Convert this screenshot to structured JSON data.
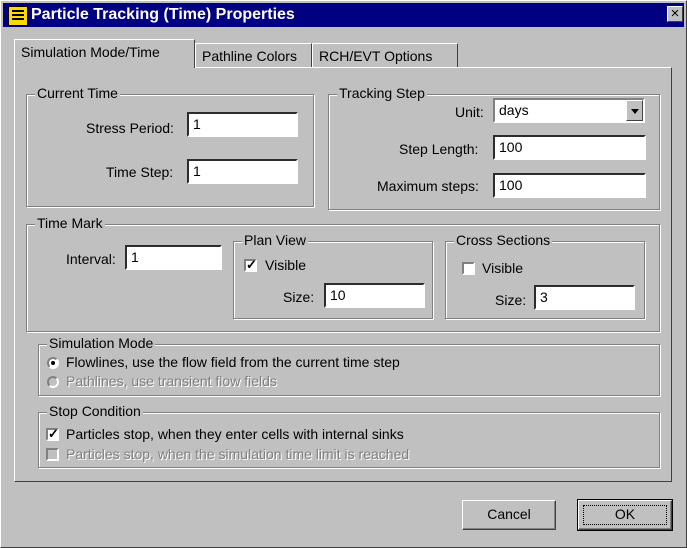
{
  "window": {
    "title": "Particle Tracking (Time) Properties",
    "close_label": "×"
  },
  "tabs": [
    {
      "label": "Simulation Mode/Time"
    },
    {
      "label": "Pathline Colors"
    },
    {
      "label": "RCH/EVT Options"
    }
  ],
  "current_time": {
    "legend": "Current Time",
    "stress_period_label": "Stress Period:",
    "stress_period_value": "1",
    "time_step_label": "Time Step:",
    "time_step_value": "1"
  },
  "tracking_step": {
    "legend": "Tracking Step",
    "unit_label": "Unit:",
    "unit_value": "days",
    "step_length_label": "Step Length:",
    "step_length_value": "100",
    "max_steps_label": "Maximum steps:",
    "max_steps_value": "100"
  },
  "time_mark": {
    "legend": "Time Mark",
    "interval_label": "Interval:",
    "interval_value": "1",
    "plan_view": {
      "legend": "Plan View",
      "visible_label": "Visible",
      "visible_checked": true,
      "size_label": "Size:",
      "size_value": "10"
    },
    "cross_sections": {
      "legend": "Cross Sections",
      "visible_label": "Visible",
      "visible_checked": false,
      "size_label": "Size:",
      "size_value": "3"
    }
  },
  "simulation_mode": {
    "legend": "Simulation Mode",
    "option_flowlines": "Flowlines, use the flow field from the current time step",
    "option_pathlines": "Pathlines, use transient flow fields",
    "selected": "flowlines"
  },
  "stop_condition": {
    "legend": "Stop Condition",
    "sinks_label": "Particles stop, when they enter cells with internal sinks",
    "sinks_checked": true,
    "time_limit_label": "Particles stop, when the simulation time limit is reached",
    "time_limit_checked": false
  },
  "buttons": {
    "cancel": "Cancel",
    "ok": "OK"
  }
}
